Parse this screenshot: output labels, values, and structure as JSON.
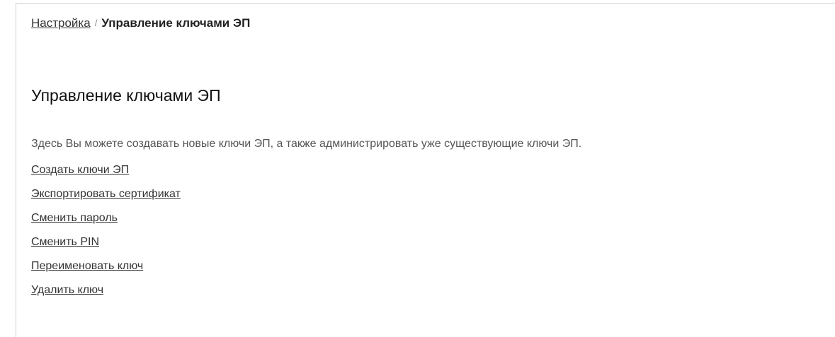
{
  "breadcrumb": {
    "parent": "Настройка",
    "separator": "/",
    "current": "Управление ключами ЭП"
  },
  "page": {
    "title": "Управление ключами ЭП",
    "description": "Здесь Вы можете создавать новые ключи ЭП, а также администрировать уже существующие ключи ЭП."
  },
  "actions": [
    {
      "label": "Создать ключи ЭП"
    },
    {
      "label": "Экспортировать сертификат"
    },
    {
      "label": "Сменить пароль"
    },
    {
      "label": "Сменить PIN"
    },
    {
      "label": "Переименовать ключ"
    },
    {
      "label": "Удалить ключ"
    }
  ]
}
